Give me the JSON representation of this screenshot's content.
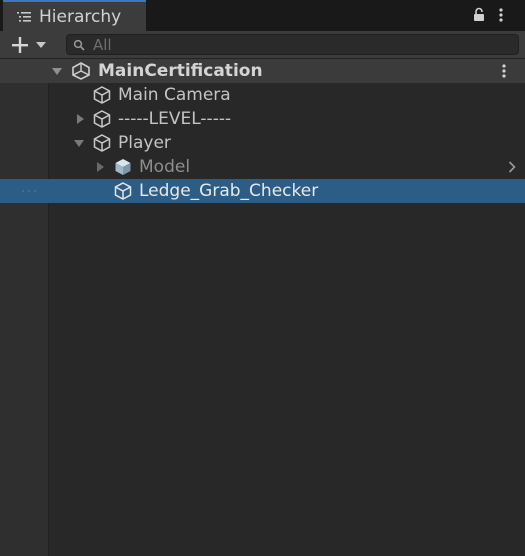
{
  "window": {
    "tab_title": "Hierarchy"
  },
  "toolbar": {
    "search_placeholder": "All"
  },
  "tree": {
    "scene_name": "MainCertification",
    "items": [
      {
        "label": "Main Camera"
      },
      {
        "label": "-----LEVEL-----"
      },
      {
        "label": "Player"
      },
      {
        "label": "Model"
      },
      {
        "label": "Ledge_Grab_Checker"
      }
    ]
  },
  "colors": {
    "accent": "#3a79bb",
    "selection": "#2c5d87",
    "background": "#282828",
    "toolbar": "#3c3c3c"
  },
  "icons": [
    "hierarchy-list-icon",
    "lock-icon",
    "kebab-menu-icon",
    "plus-icon",
    "search-icon",
    "unity-scene-icon",
    "gameobject-cube-icon",
    "prefab-cube-icon",
    "foldout-arrow-icon",
    "chevron-right-icon"
  ]
}
